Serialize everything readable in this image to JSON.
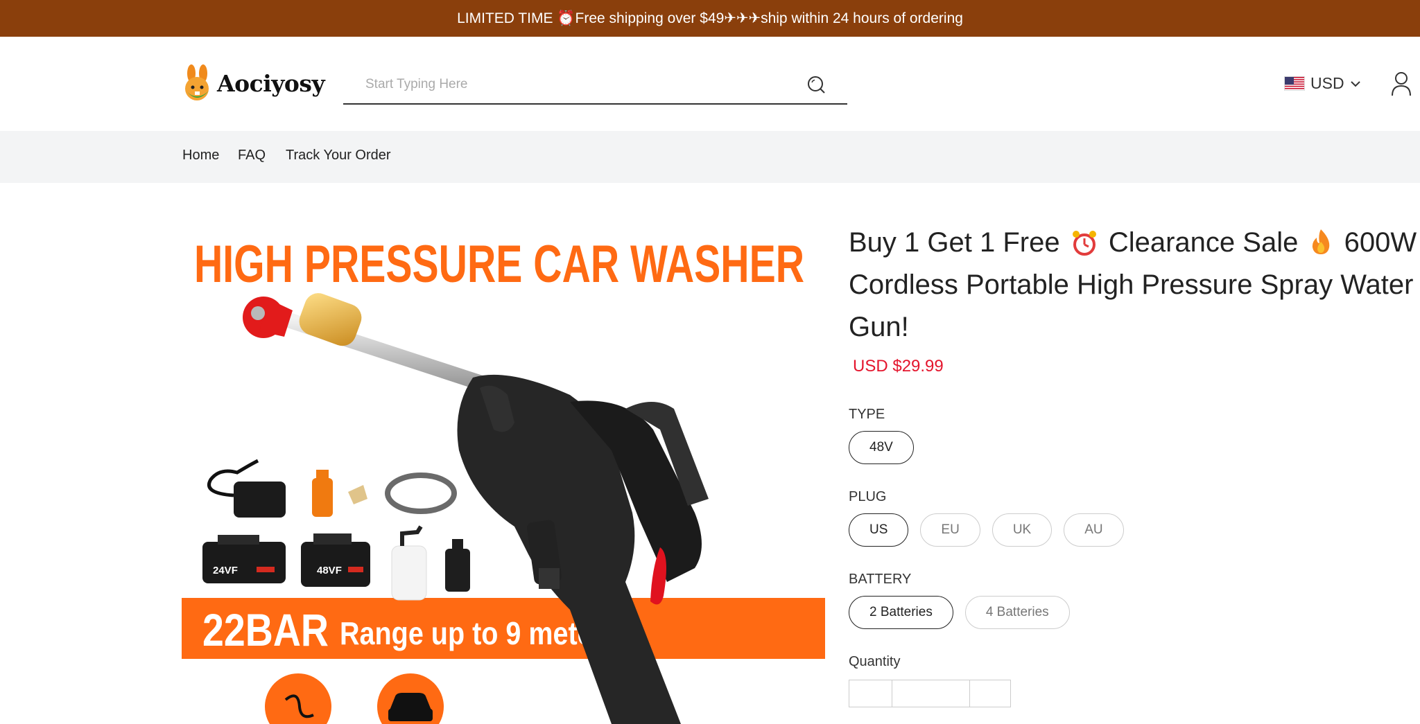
{
  "announcement": {
    "text": "LIMITED TIME ⏰Free shipping over $49✈✈✈ship within 24 hours of ordering"
  },
  "header": {
    "logo_text": "Aociyosy",
    "search_placeholder": "Start Typing Here",
    "currency": "USD"
  },
  "nav": {
    "items": [
      "Home",
      "FAQ",
      "Track Your Order"
    ]
  },
  "product": {
    "title_part1": "Buy 1 Get 1 Free",
    "title_part2": "Clearance Sale",
    "title_part3": "600W Cordless Portable High Pressure Spray Water Gun!",
    "price": "USD $29.99",
    "image": {
      "headline": "HIGH PRESSURE CAR WASHER",
      "banner_big": "22BAR",
      "banner_small": "Range up to 9 meters",
      "battery_1": "24VF",
      "battery_2": "48VF"
    },
    "options": {
      "type": {
        "label": "TYPE",
        "values": [
          "48V"
        ],
        "selected": "48V"
      },
      "plug": {
        "label": "PLUG",
        "values": [
          "US",
          "EU",
          "UK",
          "AU"
        ],
        "selected": "US"
      },
      "battery": {
        "label": "BATTERY",
        "values": [
          "2 Batteries",
          "4 Batteries"
        ],
        "selected": "2 Batteries"
      }
    },
    "quantity_label": "Quantity"
  },
  "colors": {
    "announcement_bg": "#8a3f0c",
    "price": "#e4152d",
    "banner_orange": "#ff6a13",
    "nav_bg": "#f3f4f5"
  }
}
